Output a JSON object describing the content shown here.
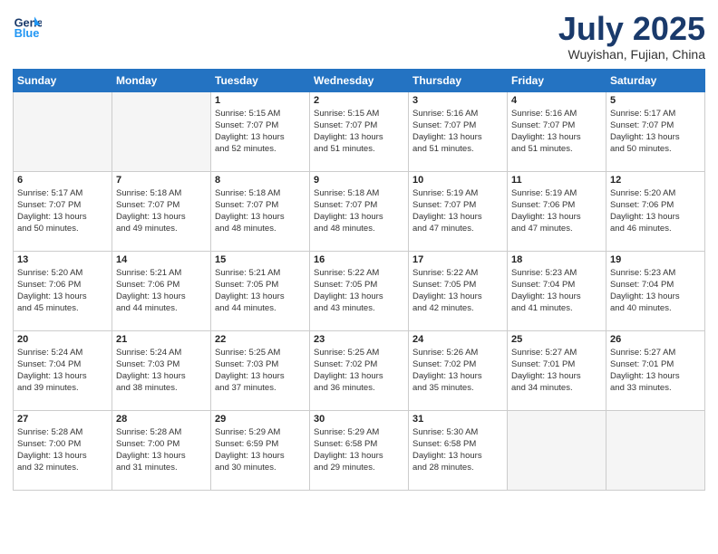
{
  "header": {
    "logo_line1": "General",
    "logo_line2": "Blue",
    "month_title": "July 2025",
    "location": "Wuyishan, Fujian, China"
  },
  "days_of_week": [
    "Sunday",
    "Monday",
    "Tuesday",
    "Wednesday",
    "Thursday",
    "Friday",
    "Saturday"
  ],
  "weeks": [
    [
      {
        "day": "",
        "info": ""
      },
      {
        "day": "",
        "info": ""
      },
      {
        "day": "1",
        "info": "Sunrise: 5:15 AM\nSunset: 7:07 PM\nDaylight: 13 hours\nand 52 minutes."
      },
      {
        "day": "2",
        "info": "Sunrise: 5:15 AM\nSunset: 7:07 PM\nDaylight: 13 hours\nand 51 minutes."
      },
      {
        "day": "3",
        "info": "Sunrise: 5:16 AM\nSunset: 7:07 PM\nDaylight: 13 hours\nand 51 minutes."
      },
      {
        "day": "4",
        "info": "Sunrise: 5:16 AM\nSunset: 7:07 PM\nDaylight: 13 hours\nand 51 minutes."
      },
      {
        "day": "5",
        "info": "Sunrise: 5:17 AM\nSunset: 7:07 PM\nDaylight: 13 hours\nand 50 minutes."
      }
    ],
    [
      {
        "day": "6",
        "info": "Sunrise: 5:17 AM\nSunset: 7:07 PM\nDaylight: 13 hours\nand 50 minutes."
      },
      {
        "day": "7",
        "info": "Sunrise: 5:18 AM\nSunset: 7:07 PM\nDaylight: 13 hours\nand 49 minutes."
      },
      {
        "day": "8",
        "info": "Sunrise: 5:18 AM\nSunset: 7:07 PM\nDaylight: 13 hours\nand 48 minutes."
      },
      {
        "day": "9",
        "info": "Sunrise: 5:18 AM\nSunset: 7:07 PM\nDaylight: 13 hours\nand 48 minutes."
      },
      {
        "day": "10",
        "info": "Sunrise: 5:19 AM\nSunset: 7:07 PM\nDaylight: 13 hours\nand 47 minutes."
      },
      {
        "day": "11",
        "info": "Sunrise: 5:19 AM\nSunset: 7:06 PM\nDaylight: 13 hours\nand 47 minutes."
      },
      {
        "day": "12",
        "info": "Sunrise: 5:20 AM\nSunset: 7:06 PM\nDaylight: 13 hours\nand 46 minutes."
      }
    ],
    [
      {
        "day": "13",
        "info": "Sunrise: 5:20 AM\nSunset: 7:06 PM\nDaylight: 13 hours\nand 45 minutes."
      },
      {
        "day": "14",
        "info": "Sunrise: 5:21 AM\nSunset: 7:06 PM\nDaylight: 13 hours\nand 44 minutes."
      },
      {
        "day": "15",
        "info": "Sunrise: 5:21 AM\nSunset: 7:05 PM\nDaylight: 13 hours\nand 44 minutes."
      },
      {
        "day": "16",
        "info": "Sunrise: 5:22 AM\nSunset: 7:05 PM\nDaylight: 13 hours\nand 43 minutes."
      },
      {
        "day": "17",
        "info": "Sunrise: 5:22 AM\nSunset: 7:05 PM\nDaylight: 13 hours\nand 42 minutes."
      },
      {
        "day": "18",
        "info": "Sunrise: 5:23 AM\nSunset: 7:04 PM\nDaylight: 13 hours\nand 41 minutes."
      },
      {
        "day": "19",
        "info": "Sunrise: 5:23 AM\nSunset: 7:04 PM\nDaylight: 13 hours\nand 40 minutes."
      }
    ],
    [
      {
        "day": "20",
        "info": "Sunrise: 5:24 AM\nSunset: 7:04 PM\nDaylight: 13 hours\nand 39 minutes."
      },
      {
        "day": "21",
        "info": "Sunrise: 5:24 AM\nSunset: 7:03 PM\nDaylight: 13 hours\nand 38 minutes."
      },
      {
        "day": "22",
        "info": "Sunrise: 5:25 AM\nSunset: 7:03 PM\nDaylight: 13 hours\nand 37 minutes."
      },
      {
        "day": "23",
        "info": "Sunrise: 5:25 AM\nSunset: 7:02 PM\nDaylight: 13 hours\nand 36 minutes."
      },
      {
        "day": "24",
        "info": "Sunrise: 5:26 AM\nSunset: 7:02 PM\nDaylight: 13 hours\nand 35 minutes."
      },
      {
        "day": "25",
        "info": "Sunrise: 5:27 AM\nSunset: 7:01 PM\nDaylight: 13 hours\nand 34 minutes."
      },
      {
        "day": "26",
        "info": "Sunrise: 5:27 AM\nSunset: 7:01 PM\nDaylight: 13 hours\nand 33 minutes."
      }
    ],
    [
      {
        "day": "27",
        "info": "Sunrise: 5:28 AM\nSunset: 7:00 PM\nDaylight: 13 hours\nand 32 minutes."
      },
      {
        "day": "28",
        "info": "Sunrise: 5:28 AM\nSunset: 7:00 PM\nDaylight: 13 hours\nand 31 minutes."
      },
      {
        "day": "29",
        "info": "Sunrise: 5:29 AM\nSunset: 6:59 PM\nDaylight: 13 hours\nand 30 minutes."
      },
      {
        "day": "30",
        "info": "Sunrise: 5:29 AM\nSunset: 6:58 PM\nDaylight: 13 hours\nand 29 minutes."
      },
      {
        "day": "31",
        "info": "Sunrise: 5:30 AM\nSunset: 6:58 PM\nDaylight: 13 hours\nand 28 minutes."
      },
      {
        "day": "",
        "info": ""
      },
      {
        "day": "",
        "info": ""
      }
    ]
  ]
}
